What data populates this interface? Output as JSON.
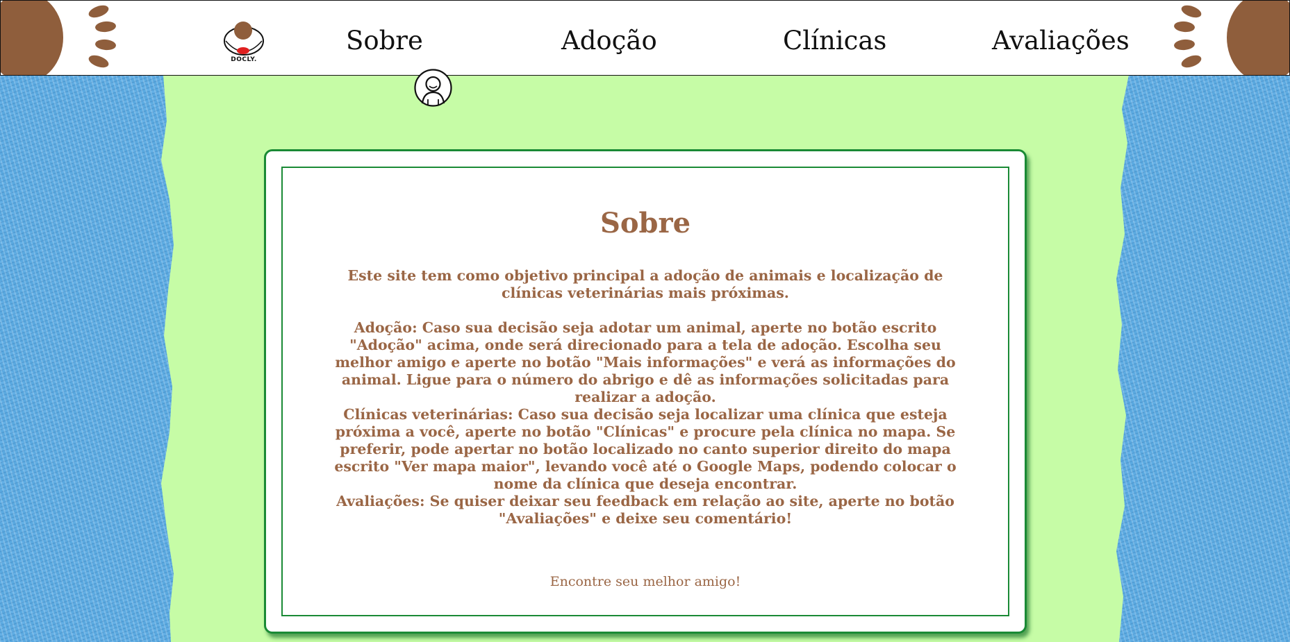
{
  "header": {
    "logo_text": "DOCLY.",
    "nav": [
      {
        "label": "Sobre"
      },
      {
        "label": "Adoção"
      },
      {
        "label": "Clínicas"
      },
      {
        "label": "Avaliações"
      }
    ]
  },
  "content": {
    "title": "Sobre",
    "paragraphs": [
      "Este site tem como objetivo principal a adoção de animais e localização de clínicas veterinárias mais próximas.",
      "Adoção: Caso sua decisão seja adotar um animal, aperte no botão escrito \"Adoção\" acima, onde será direcionado para a tela de adoção. Escolha seu melhor amigo e aperte no botão \"Mais informações\" e verá as informações do animal. Ligue para o número do abrigo e dê as informações solicitadas para realizar a adoção.",
      "Clínicas veterinárias: Caso sua decisão seja localizar uma clínica que esteja próxima a você, aperte no botão \"Clínicas\" e procure pela clínica no mapa. Se preferir, pode apertar no botão localizado no canto superior direito do mapa escrito \"Ver mapa maior\", levando você até o Google Maps, podendo colocar o nome da clínica que deseja encontrar.",
      "Avaliações: Se quiser deixar seu feedback em relação ao site, aperte no botão \"Avaliações\" e deixe seu comentário!"
    ],
    "tagline": "Encontre seu melhor amigo!"
  },
  "colors": {
    "background": "#c6fca6",
    "accent_brown": "#9a6645",
    "border_green": "#1a8a35",
    "side_blue": "#5aa9e0"
  },
  "icons": [
    "paw-icon",
    "docly-logo-icon",
    "user-profile-icon"
  ]
}
